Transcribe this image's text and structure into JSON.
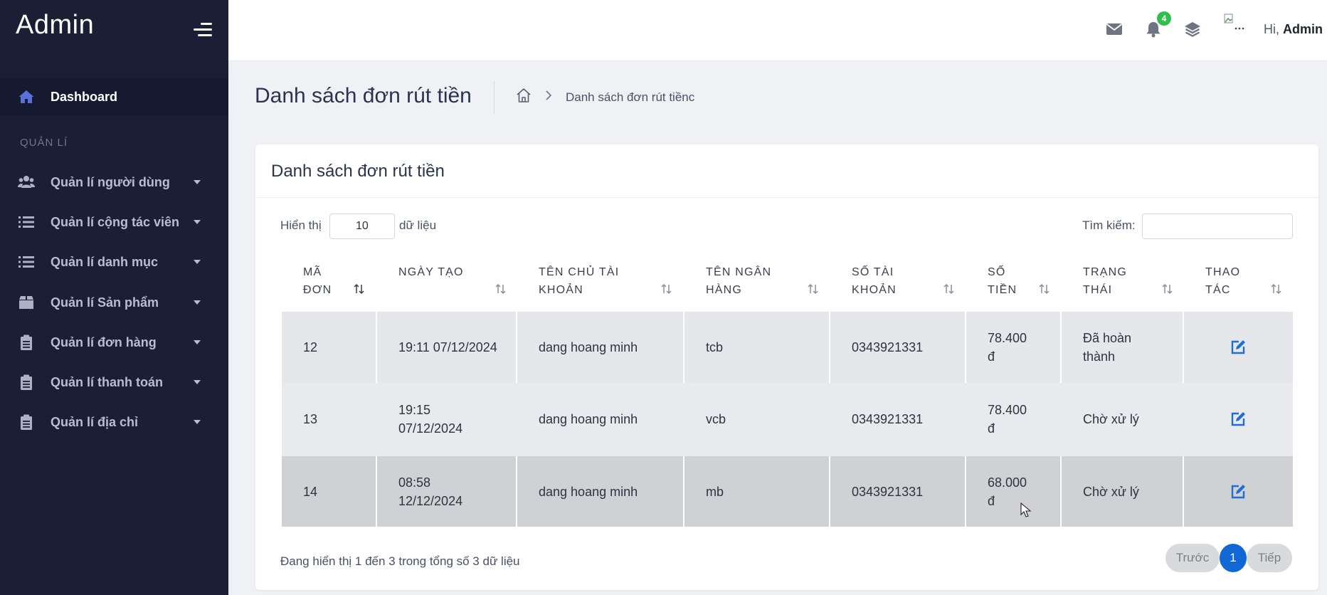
{
  "sidebar": {
    "brand": "Admin",
    "dashboard_label": "Dashboard",
    "section_title": "QUẢN LÍ",
    "items": [
      {
        "label": "Quản lí người dùng",
        "icon": "users-icon"
      },
      {
        "label": "Quản lí cộng tác viên",
        "icon": "list-icon"
      },
      {
        "label": "Quản lí danh mục",
        "icon": "list-icon"
      },
      {
        "label": "Quản lí Sản phẩm",
        "icon": "box-icon"
      },
      {
        "label": "Quản lí đơn hàng",
        "icon": "clipboard-icon"
      },
      {
        "label": "Quản lí thanh toán",
        "icon": "clipboard-icon"
      },
      {
        "label": "Quản lí địa chỉ",
        "icon": "clipboard-icon"
      }
    ]
  },
  "header": {
    "notification_count": "4",
    "greeting": "Hi,",
    "user_name": "Admin"
  },
  "page": {
    "title": "Danh sách đơn rút tiền",
    "breadcrumb_current": "Danh sách đơn rút tiềnc"
  },
  "card": {
    "title": "Danh sách đơn rút tiền",
    "show_label": "Hiển thị",
    "page_length": "10",
    "show_suffix": "dữ liệu",
    "search_label": "Tìm kiếm:",
    "search_value": ""
  },
  "table": {
    "columns": [
      "Mã\nđơn",
      "Ngày tạo",
      "Tên chủ tài\nkhoản",
      "Tên ngân\nhàng",
      "Số tài\nkhoản",
      "Số\ntiền",
      "Trạng\nthái",
      "Thao\ntác"
    ],
    "rows": [
      {
        "id": "12",
        "date": "19:11 07/12/2024",
        "owner": "dang hoang minh",
        "bank": "tcb",
        "account": "0343921331",
        "amount": "78.400\nđ",
        "status": "Đã hoàn\nthành"
      },
      {
        "id": "13",
        "date": "19:15\n07/12/2024",
        "owner": "dang hoang minh",
        "bank": "vcb",
        "account": "0343921331",
        "amount": "78.400\nđ",
        "status": "Chờ xử lý"
      },
      {
        "id": "14",
        "date": "08:58\n12/12/2024",
        "owner": "dang hoang minh",
        "bank": "mb",
        "account": "0343921331",
        "amount": "68.000\nđ",
        "status": "Chờ xử lý"
      }
    ]
  },
  "footer": {
    "info": "Đang hiển thị 1 đến 3 trong tổng số 3 dữ liệu",
    "prev_label": "Trước",
    "current_page": "1",
    "next_label": "Tiếp"
  },
  "colors": {
    "sidebar_bg": "#1b1f36",
    "accent": "#1167d6",
    "badge": "#2fbf4f"
  }
}
